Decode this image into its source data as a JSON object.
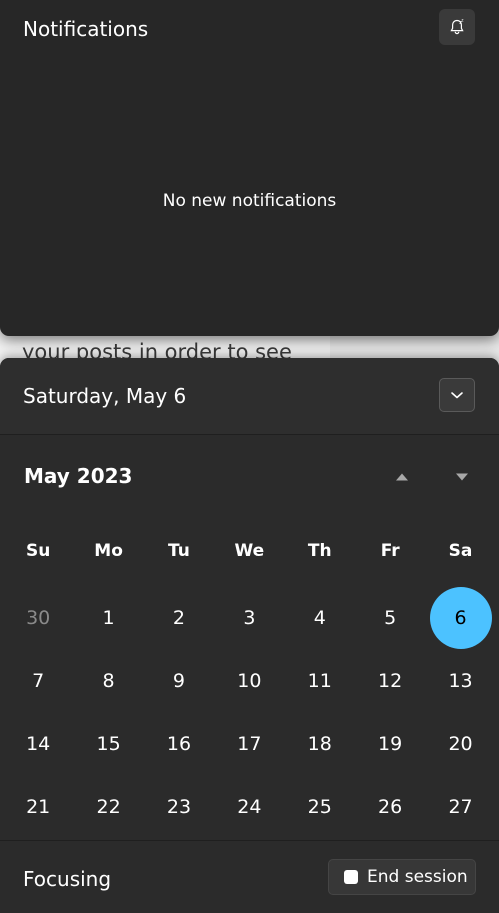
{
  "notifications": {
    "title": "Notifications",
    "empty_message": "No new notifications",
    "dnd_icon": "bell-snooze-icon"
  },
  "background": {
    "text": "your posts in order to see"
  },
  "calendar": {
    "header_date": "Saturday, May 6",
    "collapse_icon": "chevron-down-icon",
    "month_label": "May 2023",
    "weekdays": [
      "Su",
      "Mo",
      "Tu",
      "We",
      "Th",
      "Fr",
      "Sa"
    ],
    "weeks": [
      [
        "30",
        "1",
        "2",
        "3",
        "4",
        "5",
        "6"
      ],
      [
        "7",
        "8",
        "9",
        "10",
        "11",
        "12",
        "13"
      ],
      [
        "14",
        "15",
        "16",
        "17",
        "18",
        "19",
        "20"
      ],
      [
        "21",
        "22",
        "23",
        "24",
        "25",
        "26",
        "27"
      ]
    ],
    "selected_day": "6",
    "accent_color": "#4cc2ff"
  },
  "focus": {
    "label": "Focusing",
    "end_button_label": "End session"
  }
}
